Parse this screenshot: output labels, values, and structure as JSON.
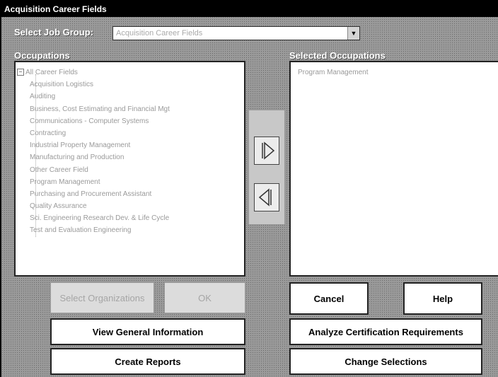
{
  "window": {
    "title": "Acquisition Career Fields"
  },
  "job_group": {
    "label": "Select Job Group:",
    "value": "Acquisition Career Fields"
  },
  "occupations": {
    "label": "Occupations",
    "root": "All Career Fields",
    "items": [
      "Acquisition Logistics",
      "Auditing",
      "Business, Cost Estimating and Financial Mgt",
      "Communications - Computer Systems",
      "Contracting",
      "Industrial Property Management",
      "Manufacturing and Production",
      "Other Career Field",
      "Program Management",
      "Purchasing and Procurement Assistant",
      "Quality Assurance",
      "Sci. Engineering Research Dev. & Life Cycle",
      "Test and Evaluation Engineering"
    ]
  },
  "selected_occupations": {
    "label": "Selected Occupations",
    "items": [
      "Program Management"
    ]
  },
  "buttons": {
    "select_organizations": "Select Organizations",
    "ok": "OK",
    "cancel": "Cancel",
    "help": "Help",
    "view_general_information": "View General Information",
    "analyze_certification": "Analyze Certification Requirements",
    "create_reports": "Create Reports",
    "change_selections": "Change Selections"
  },
  "icons": {
    "add": "triangle-right-icon",
    "remove": "triangle-left-icon"
  }
}
